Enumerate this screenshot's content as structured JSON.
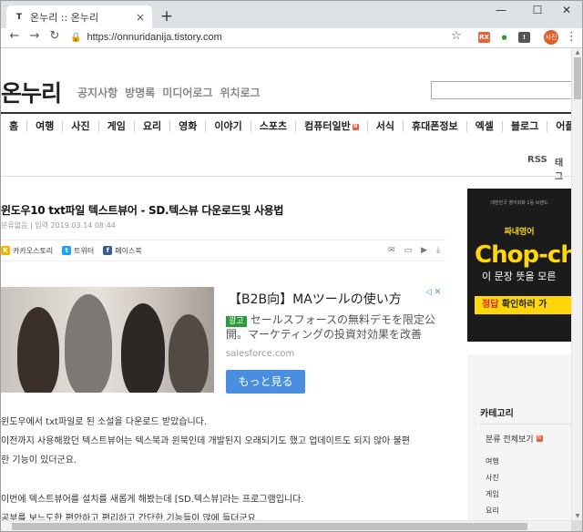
{
  "browser": {
    "tab_title": "온누리 :: 온누리",
    "favicon": "T",
    "close_glyph": "×",
    "newtab_glyph": "+",
    "url": "https://onnuridanija.tistory.com",
    "back_glyph": "←",
    "forward_glyph": "→",
    "reload_glyph": "↻",
    "lock_glyph": "🔒",
    "star_glyph": "☆",
    "ext1": "RX",
    "ext2": "●",
    "ext3": "!",
    "avatar": "사진",
    "menu_glyph": "⋮",
    "minimize": "—",
    "maximize": "☐",
    "close": "✕",
    "icons": {
      "accent": "#e25b28"
    }
  },
  "site": {
    "logo": "온누리",
    "topnav": [
      "공지사항",
      "방명록",
      "미디어로그",
      "위치로그"
    ],
    "categories": [
      "홈",
      "여행",
      "사진",
      "게임",
      "요리",
      "영화",
      "이야기",
      "스포츠",
      "컴퓨터일반",
      "서식",
      "휴대폰정보",
      "엑셀",
      "블로그",
      "어플정..."
    ],
    "category_new": "컴퓨터일반",
    "new_badge": "N",
    "rss": "RSS",
    "tag": "태그"
  },
  "post": {
    "title": "윈도우10 txt파일 텍스트뷰어 - SD.텍스뷰 다운로드및 사용법",
    "meta": "분류없음 | 입력 2019.03.14 08:44",
    "share": [
      {
        "label": "카카오스토리",
        "icon": "kakaostory-icon",
        "glyph": "K",
        "color": "#f5b400"
      },
      {
        "label": "트위터",
        "icon": "twitter-icon",
        "glyph": "t",
        "color": "#1da1f2"
      },
      {
        "label": "페이스북",
        "icon": "facebook-icon",
        "glyph": "f",
        "color": "#3b5998"
      }
    ],
    "tools": [
      "✉",
      "▭",
      "▶",
      "⤓"
    ],
    "body": [
      "윈도우에서 txt파일로 된 소설을 다운로드 받았습니다.",
      "이전까지 사용해왔던 텍스트뷰어는 텍스북과 윈북인데 개발된지 오래되기도 했고 업데이트도 되지 않아 불편",
      "한 기능이 있더군요.",
      "",
      "이번에 텍스트뷰어를 설치를 새롭게 해봤는데 [SD.텍스뷰]라는 프로그램입니다.",
      "공부를 보느도한 편안하고 편리하고 간단한 기능들이 많에 들더군요."
    ]
  },
  "ad": {
    "title": "【B2B向】MAツールの使い方",
    "badge": "광고",
    "body": "セールスフォースの無料デモを限定公開。マーケティングの投資対効果を改善",
    "domain": "salesforce.com",
    "button": "もっと見る",
    "close_glyph": "◁ ✕"
  },
  "sidebar": {
    "banner_small": "대한민국 영어회화 1등 브랜드",
    "banner_brand": "짜내영어",
    "banner_big": "Chop-ch",
    "banner_sub": "이 문장 뜻을 모른",
    "banner_cta_red": "정답",
    "banner_cta": " 확인하러 가",
    "category_head": "카테고리",
    "all_label": "분류 전체보기",
    "items": [
      "여행",
      "사진",
      "게임",
      "요리"
    ]
  }
}
